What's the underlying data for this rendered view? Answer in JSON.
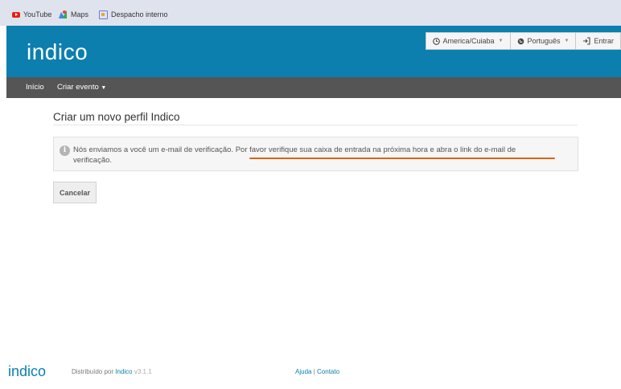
{
  "bookmarks": [
    {
      "label": "YouTube",
      "icon": "youtube-icon"
    },
    {
      "label": "Maps",
      "icon": "maps-icon"
    },
    {
      "label": "Despacho interno",
      "icon": "document-icon"
    }
  ],
  "header": {
    "logo": "indico",
    "timezone": "America/Cuiaba",
    "language": "Português",
    "login": "Entrar",
    "brand_color": "#0c7fae"
  },
  "nav": {
    "home": "Início",
    "create_event": "Criar evento"
  },
  "main": {
    "title": "Criar um novo perfil Indico",
    "alert_line1": "Nós enviamos a você um e-mail de verificação. Por favor verifique sua caixa de entrada na próxima hora e abra o link do e-mail de",
    "alert_line2": "verificação.",
    "cancel_button": "Cancelar"
  },
  "footer": {
    "logo": "indico",
    "powered_by": "Distribuído por",
    "powered_link": "Indico",
    "version": "v3.1.1",
    "help": "Ajuda",
    "separator": "|",
    "contact": "Contato"
  }
}
